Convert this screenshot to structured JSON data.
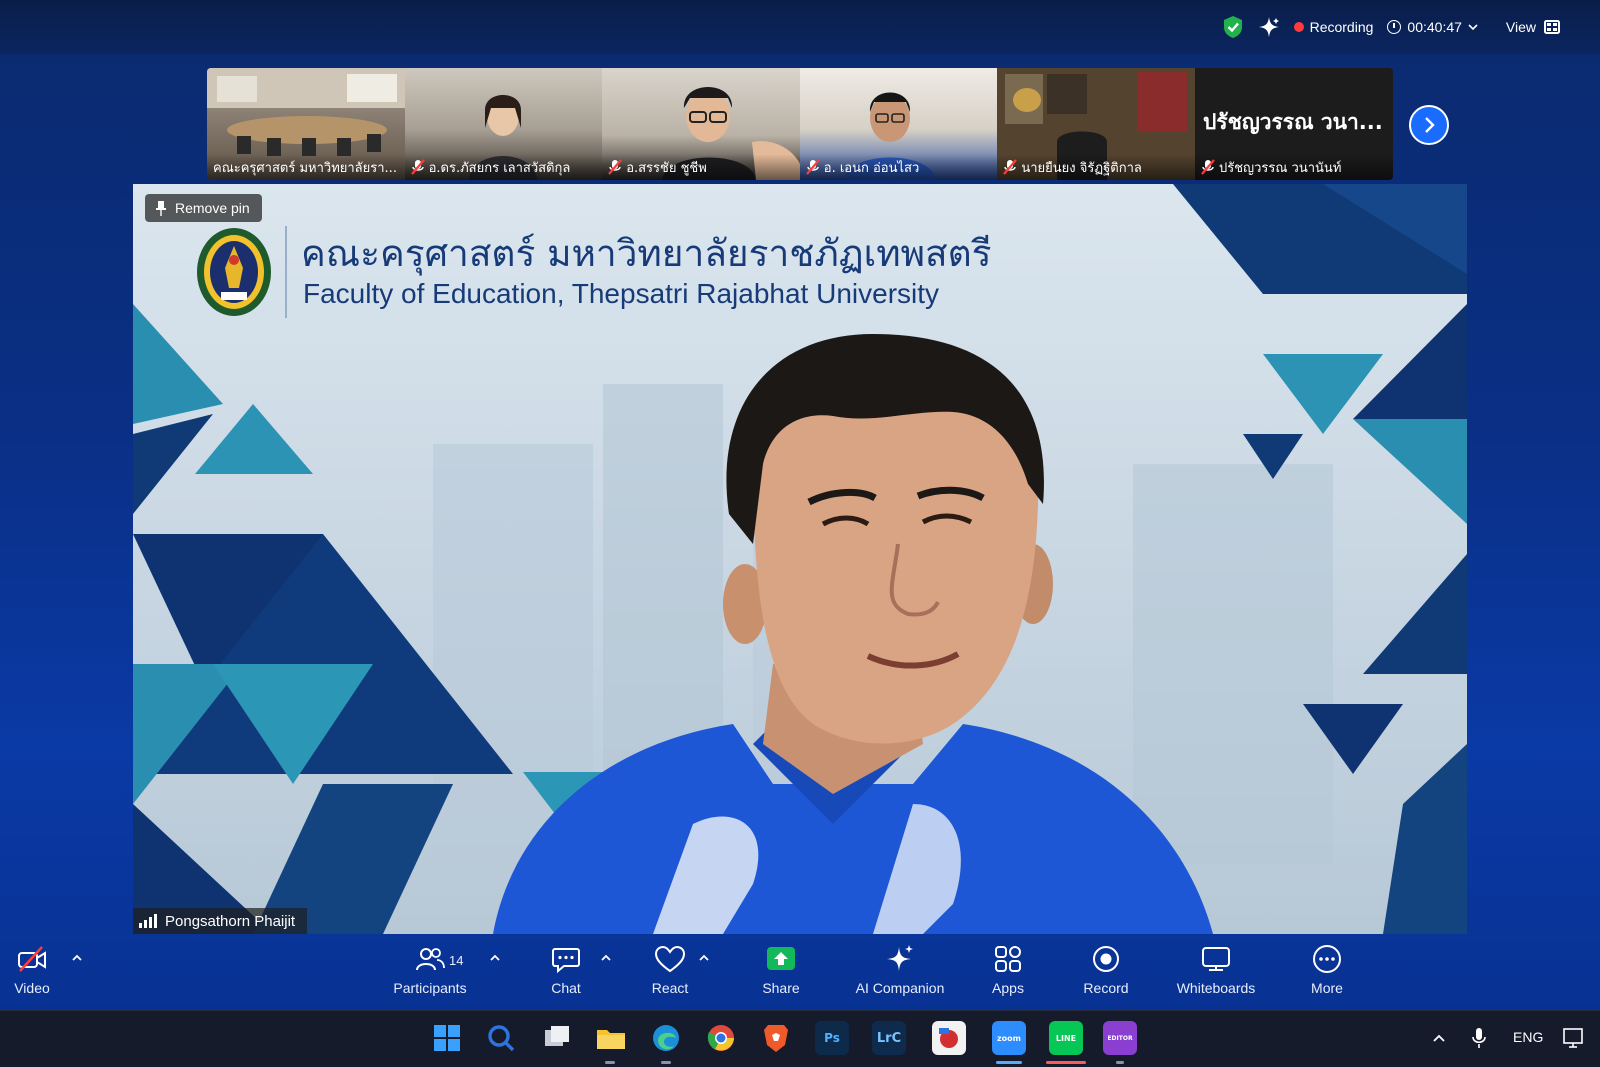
{
  "topbar": {
    "recording_label": "Recording",
    "timer": "00:40:47",
    "view_label": "View",
    "icons": [
      "shield-check-icon",
      "sparkle-icon",
      "clock-icon",
      "chevron-down-icon",
      "grid-icon"
    ]
  },
  "thumbnails": [
    {
      "name": "คณะครุศาสตร์ มหาวิทยาลัยรา...",
      "muted": false
    },
    {
      "name": "อ.ดร.ภัสยกร เลาสวัสดิกุล",
      "muted": true
    },
    {
      "name": "อ.สรรชัย ชูชีพ",
      "muted": true
    },
    {
      "name": "อ. เอนก อ่อนไสว",
      "muted": true
    },
    {
      "name": "นายยืนยง จิรัฏฐิติกาล",
      "muted": true
    },
    {
      "name": "ปรัชญวรรณ วนานันท์",
      "muted": true,
      "display_text": "ปรัชญวรรณ วนา..."
    }
  ],
  "main_video": {
    "remove_pin_label": "Remove pin",
    "title_th": "คณะครุศาสตร์ มหาวิทยาลัยราชภัฏเทพสตรี",
    "title_en": "Faculty of Education, Thepsatri Rajabhat University",
    "speaker_name": "Pongsathorn Phaijit"
  },
  "toolbar": {
    "video_label": "Video",
    "participants_label": "Participants",
    "participants_count": "14",
    "chat_label": "Chat",
    "react_label": "React",
    "share_label": "Share",
    "ai_label": "AI Companion",
    "apps_label": "Apps",
    "record_label": "Record",
    "whiteboards_label": "Whiteboards",
    "more_label": "More"
  },
  "taskbar": {
    "apps": [
      {
        "name": "windows-start",
        "color": "#3aa0ff"
      },
      {
        "name": "search",
        "color": "#2b74e2"
      },
      {
        "name": "task-view",
        "color": "#9aa3b5"
      },
      {
        "name": "file-explorer",
        "color": "#f4c430"
      },
      {
        "name": "edge",
        "color": "#1d8fd8"
      },
      {
        "name": "chrome",
        "color": "#e04a3a"
      },
      {
        "name": "brave",
        "color": "#f0592a"
      },
      {
        "name": "photoshop",
        "label": "Ps",
        "color": "#0d2a4a"
      },
      {
        "name": "lightroom-classic",
        "label": "LrC",
        "color": "#0e2b4e"
      },
      {
        "name": "photo-app",
        "color": "#d23030"
      },
      {
        "name": "zoom",
        "label": "zoom",
        "color": "#2d8cff"
      },
      {
        "name": "line",
        "label": "LINE",
        "color": "#06c755"
      },
      {
        "name": "editor",
        "label": "EDITOR",
        "color": "#8a3fd1"
      }
    ],
    "lang": "ENG"
  },
  "colors": {
    "accent_blue": "#1a6cff",
    "recording_red": "#ff3b3b",
    "title_blue": "#173a78"
  }
}
